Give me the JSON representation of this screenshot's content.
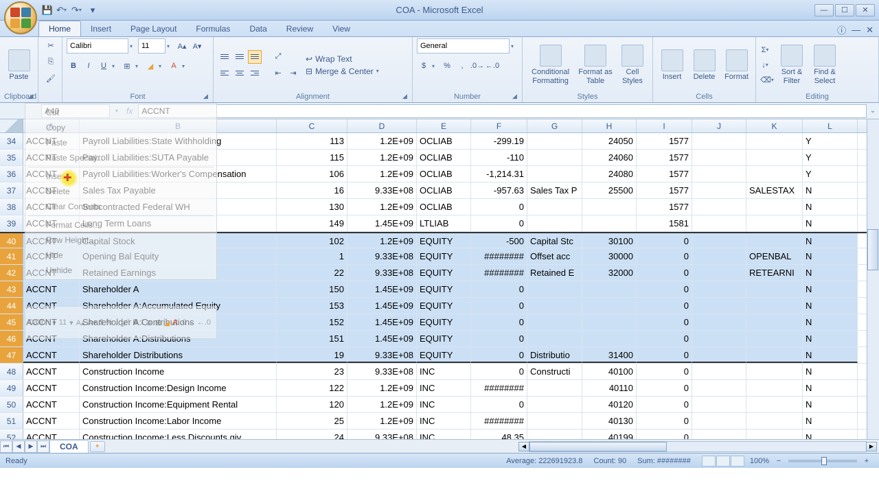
{
  "title": "COA - Microsoft Excel",
  "tabs": [
    "Home",
    "Insert",
    "Page Layout",
    "Formulas",
    "Data",
    "Review",
    "View"
  ],
  "active_tab": "Home",
  "groups": {
    "clipboard": "Clipboard",
    "font": "Font",
    "alignment": "Alignment",
    "number": "Number",
    "styles": "Styles",
    "cells": "Cells",
    "editing": "Editing"
  },
  "font": {
    "name": "Calibri",
    "size": "11"
  },
  "number_format": "General",
  "paste_label": "Paste",
  "wrap_label": "Wrap Text",
  "merge_label": "Merge & Center",
  "cond_fmt": "Conditional Formatting",
  "fmt_table": "Format as Table",
  "cell_styles": "Cell Styles",
  "insert_btn": "Insert",
  "delete_btn": "Delete",
  "format_btn": "Format",
  "sort_filter": "Sort & Filter",
  "find_select": "Find & Select",
  "name_box": "A40",
  "formula_value": "ACCNT",
  "columns": [
    "A",
    "B",
    "C",
    "D",
    "E",
    "F",
    "G",
    "H",
    "I",
    "J",
    "K",
    "L"
  ],
  "sheet_name": "COA",
  "status": "Ready",
  "stats": {
    "avg_label": "Average:",
    "avg": "222691923.8",
    "cnt_label": "Count:",
    "cnt": "90",
    "sum_label": "Sum:",
    "sum": "########"
  },
  "zoom": "100%",
  "context_menu": [
    "Cut",
    "Copy",
    "Paste",
    "Paste Special...",
    "Insert",
    "Delete",
    "Clear Contents",
    "Format Cells...",
    "Row Height...",
    "Hide",
    "Unhide"
  ],
  "rows": [
    {
      "n": 34,
      "A": "ACCNT",
      "B": "Payroll Liabilities:State Withholding",
      "C": "113",
      "D": "1.2E+09",
      "E": "OCLIAB",
      "F": "-299.19",
      "G": "",
      "H": "24050",
      "I": "1577",
      "J": "",
      "K": "",
      "L": "Y"
    },
    {
      "n": 35,
      "A": "ACCNT",
      "B": "Payroll Liabilities:SUTA Payable",
      "C": "115",
      "D": "1.2E+09",
      "E": "OCLIAB",
      "F": "-110",
      "G": "",
      "H": "24060",
      "I": "1577",
      "J": "",
      "K": "",
      "L": "Y"
    },
    {
      "n": 36,
      "A": "ACCNT",
      "B": "Payroll Liabilities:Worker's Compensation",
      "C": "106",
      "D": "1.2E+09",
      "E": "OCLIAB",
      "F": "-1,214.31",
      "G": "",
      "H": "24080",
      "I": "1577",
      "J": "",
      "K": "",
      "L": "Y"
    },
    {
      "n": 37,
      "A": "ACCNT",
      "B": "Sales Tax Payable",
      "C": "16",
      "D": "9.33E+08",
      "E": "OCLIAB",
      "F": "-957.63",
      "G": "Sales Tax P",
      "H": "25500",
      "I": "1577",
      "J": "",
      "K": "SALESTAX",
      "L": "N"
    },
    {
      "n": 38,
      "A": "ACCNT",
      "B": "Subcontracted Federal WH",
      "C": "130",
      "D": "1.2E+09",
      "E": "OCLIAB",
      "F": "0",
      "G": "",
      "H": "",
      "I": "1577",
      "J": "",
      "K": "",
      "L": "N"
    },
    {
      "n": 39,
      "A": "ACCNT",
      "B": "Long Term Loans",
      "C": "149",
      "D": "1.45E+09",
      "E": "LTLIAB",
      "F": "0",
      "G": "",
      "H": "",
      "I": "1581",
      "J": "",
      "K": "",
      "L": "N"
    },
    {
      "n": 40,
      "A": "ACCNT",
      "B": "Capital Stock",
      "C": "102",
      "D": "1.2E+09",
      "E": "EQUITY",
      "F": "-500",
      "G": "Capital Stc",
      "H": "30100",
      "I": "0",
      "J": "",
      "K": "",
      "L": "N"
    },
    {
      "n": 41,
      "A": "ACCNT",
      "B": "Opening Bal Equity",
      "C": "1",
      "D": "9.33E+08",
      "E": "EQUITY",
      "F": "########",
      "G": "Offset acc",
      "H": "30000",
      "I": "0",
      "J": "",
      "K": "OPENBAL",
      "L": "N"
    },
    {
      "n": 42,
      "A": "ACCNT",
      "B": "Retained Earnings",
      "C": "22",
      "D": "9.33E+08",
      "E": "EQUITY",
      "F": "########",
      "G": "Retained E",
      "H": "32000",
      "I": "0",
      "J": "",
      "K": "RETEARNI",
      "L": "N"
    },
    {
      "n": 43,
      "A": "ACCNT",
      "B": "Shareholder A",
      "C": "150",
      "D": "1.45E+09",
      "E": "EQUITY",
      "F": "0",
      "G": "",
      "H": "",
      "I": "0",
      "J": "",
      "K": "",
      "L": "N"
    },
    {
      "n": 44,
      "A": "ACCNT",
      "B": "Shareholder A:Accumulated Equity",
      "C": "153",
      "D": "1.45E+09",
      "E": "EQUITY",
      "F": "0",
      "G": "",
      "H": "",
      "I": "0",
      "J": "",
      "K": "",
      "L": "N"
    },
    {
      "n": 45,
      "A": "ACCNT",
      "B": "Shareholder A:Contributions",
      "C": "152",
      "D": "1.45E+09",
      "E": "EQUITY",
      "F": "0",
      "G": "",
      "H": "",
      "I": "0",
      "J": "",
      "K": "",
      "L": "N"
    },
    {
      "n": 46,
      "A": "ACCNT",
      "B": "Shareholder A:Distributions",
      "C": "151",
      "D": "1.45E+09",
      "E": "EQUITY",
      "F": "0",
      "G": "",
      "H": "",
      "I": "0",
      "J": "",
      "K": "",
      "L": "N"
    },
    {
      "n": 47,
      "A": "ACCNT",
      "B": "Shareholder Distributions",
      "C": "19",
      "D": "9.33E+08",
      "E": "EQUITY",
      "F": "0",
      "G": "Distributio",
      "H": "31400",
      "I": "0",
      "J": "",
      "K": "",
      "L": "N"
    },
    {
      "n": 48,
      "A": "ACCNT",
      "B": "Construction Income",
      "C": "23",
      "D": "9.33E+08",
      "E": "INC",
      "F": "0",
      "G": "Constructi",
      "H": "40100",
      "I": "0",
      "J": "",
      "K": "",
      "L": "N"
    },
    {
      "n": 49,
      "A": "ACCNT",
      "B": "Construction Income:Design Income",
      "C": "122",
      "D": "1.2E+09",
      "E": "INC",
      "F": "########",
      "G": "",
      "H": "40110",
      "I": "0",
      "J": "",
      "K": "",
      "L": "N"
    },
    {
      "n": 50,
      "A": "ACCNT",
      "B": "Construction Income:Equipment Rental",
      "C": "120",
      "D": "1.2E+09",
      "E": "INC",
      "F": "0",
      "G": "",
      "H": "40120",
      "I": "0",
      "J": "",
      "K": "",
      "L": "N"
    },
    {
      "n": 51,
      "A": "ACCNT",
      "B": "Construction Income:Labor Income",
      "C": "25",
      "D": "1.2E+09",
      "E": "INC",
      "F": "########",
      "G": "",
      "H": "40130",
      "I": "0",
      "J": "",
      "K": "",
      "L": "N"
    },
    {
      "n": 52,
      "A": "ACCNT",
      "B": "Construction Income:Less Discounts giv",
      "C": "24",
      "D": "9.33E+08",
      "E": "INC",
      "F": "48.35",
      "G": "",
      "H": "40199",
      "I": "0",
      "J": "",
      "K": "",
      "L": "N"
    }
  ]
}
